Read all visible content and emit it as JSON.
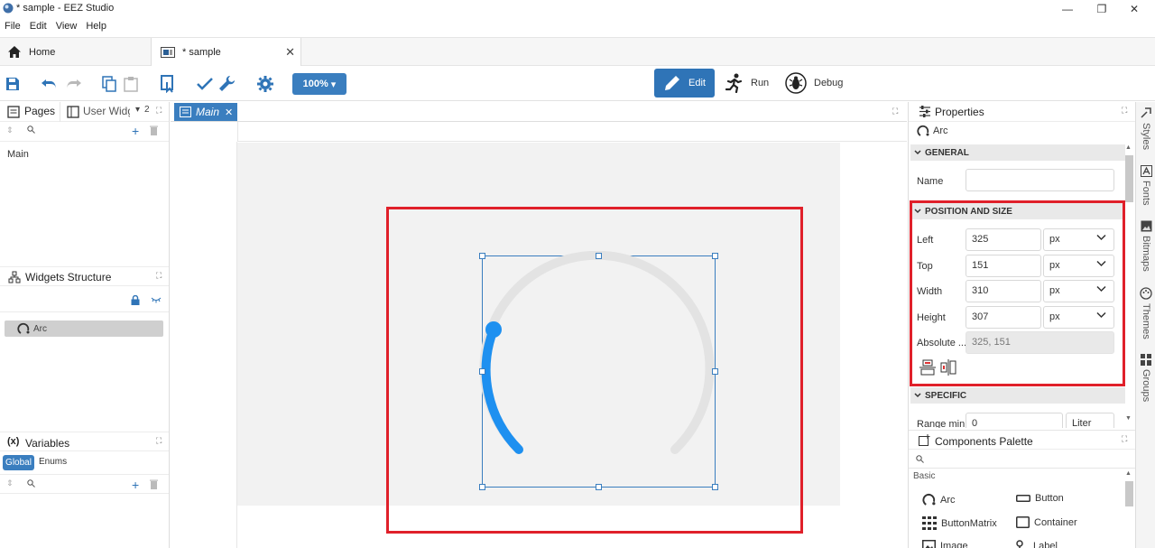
{
  "window": {
    "title": "* sample - EEZ Studio",
    "minimize": "—",
    "maximize": "❐",
    "close": "✕"
  },
  "menu": [
    "File",
    "Edit",
    "View",
    "Help"
  ],
  "tabs": {
    "home": "Home",
    "sample": "* sample"
  },
  "toolbar": {
    "zoom": "100%",
    "edit": "Edit",
    "run": "Run",
    "debug": "Debug"
  },
  "left": {
    "pages_tab": "Pages",
    "user_widgets_tab": "User Widg",
    "overflow_count": "2",
    "pages": [
      "Main"
    ],
    "widgets_structure": "Widgets Structure",
    "tree_items": [
      "Arc"
    ],
    "variables": "Variables",
    "variables_prefix": "(x)",
    "var_tabs": [
      "Global",
      "Enums"
    ]
  },
  "editor": {
    "tab": "Main"
  },
  "properties": {
    "title": "Properties",
    "component": "Arc",
    "general": "GENERAL",
    "name_label": "Name",
    "name_value": "",
    "position_and_size": "POSITION AND SIZE",
    "left_label": "Left",
    "left_value": "325",
    "left_unit": "px",
    "top_label": "Top",
    "top_value": "151",
    "top_unit": "px",
    "width_label": "Width",
    "width_value": "310",
    "width_unit": "px",
    "height_label": "Height",
    "height_value": "307",
    "height_unit": "px",
    "absolute_label": "Absolute ...",
    "absolute_value": "325, 151",
    "specific": "SPECIFIC",
    "range_min_label": "Range min",
    "range_min_value": "0",
    "range_min_unit": "Liter"
  },
  "palette": {
    "title": "Components Palette",
    "section": "Basic",
    "items": [
      "Arc",
      "Button",
      "ButtonMatrix",
      "Container",
      "Image",
      "Label"
    ]
  },
  "rail": [
    "Styles",
    "Fonts",
    "Bitmaps",
    "Themes",
    "Groups"
  ],
  "colors": {
    "accent": "#2f74b7",
    "arc_value": "#1e90f0",
    "arc_track": "#e3e3e3",
    "highlight": "#e0202a"
  }
}
